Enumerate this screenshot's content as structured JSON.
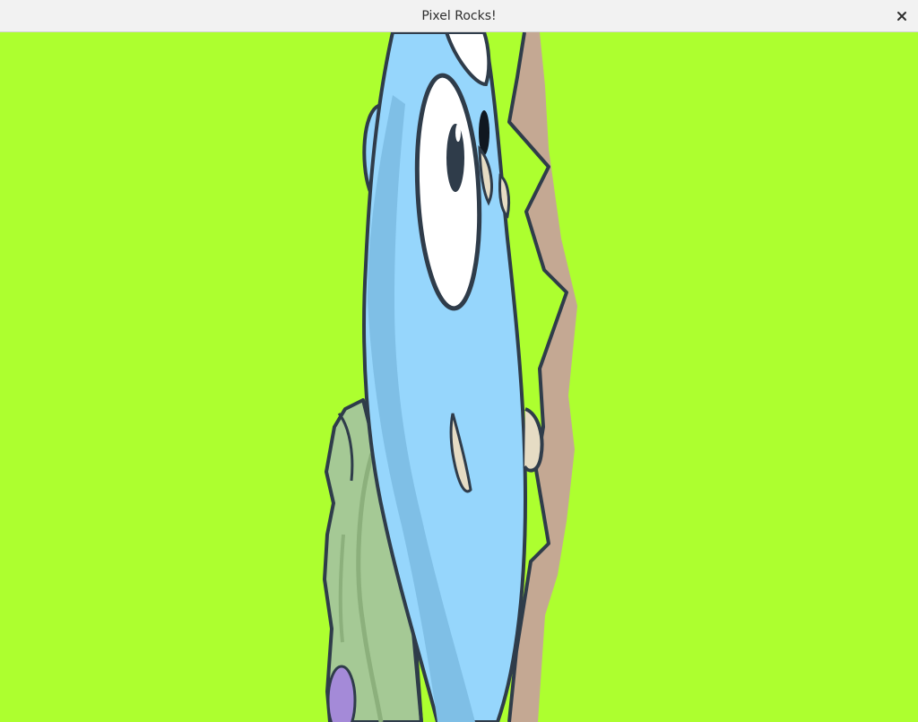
{
  "window": {
    "title": "Pixel Rocks!",
    "close_icon": "close-icon"
  },
  "scene": {
    "background_color": "#adff2f",
    "characters": [
      "gopher",
      "green-creature",
      "rock-wall"
    ],
    "colors": {
      "gopher_body": "#96d6fc",
      "gopher_shade": "#7fbfe6",
      "outline": "#2f3c4a",
      "green_creature": "#a5c995",
      "green_creature_shade": "#8cb07c",
      "rock": "#c4a893",
      "tooth": "#e6dcc4",
      "purple": "#a48ad8"
    }
  }
}
